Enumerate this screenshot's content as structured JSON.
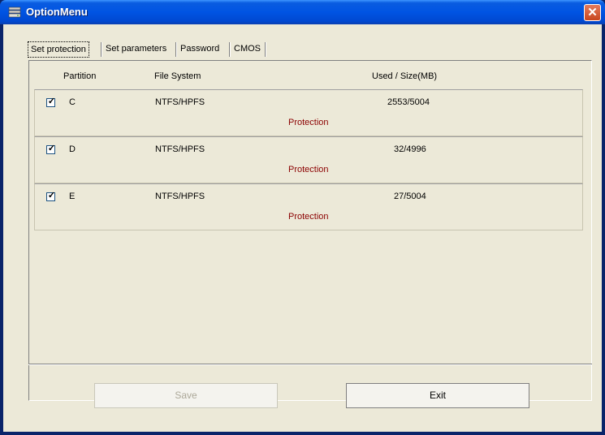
{
  "window": {
    "title": "OptionMenu",
    "close_glyph": "✕"
  },
  "tabs": [
    {
      "label": "Set protection",
      "active": true
    },
    {
      "label": "Set parameters",
      "active": false
    },
    {
      "label": "Password",
      "active": false
    },
    {
      "label": "CMOS",
      "active": false
    }
  ],
  "table": {
    "headers": {
      "partition": "Partition",
      "file_system": "File System",
      "used_size": "Used / Size(MB)"
    },
    "rows": [
      {
        "checked": true,
        "partition": "C",
        "file_system": "NTFS/HPFS",
        "used_size": "2553/5004",
        "status": "Protection"
      },
      {
        "checked": true,
        "partition": "D",
        "file_system": "NTFS/HPFS",
        "used_size": "32/4996",
        "status": "Protection"
      },
      {
        "checked": true,
        "partition": "E",
        "file_system": "NTFS/HPFS",
        "used_size": "27/5004",
        "status": "Protection"
      }
    ],
    "check_glyph": "✓"
  },
  "buttons": {
    "save": "Save",
    "exit": "Exit"
  },
  "colors": {
    "title_bar": "#0054e3",
    "client_bg": "#ece9d8",
    "status_text": "#8b0000",
    "close_button": "#c8461e"
  }
}
